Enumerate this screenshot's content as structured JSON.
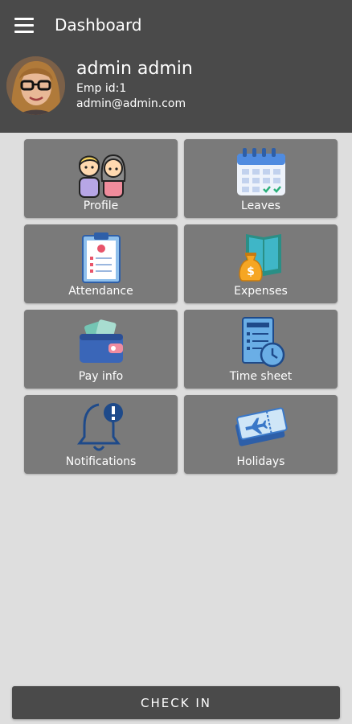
{
  "appbar": {
    "title": "Dashboard",
    "menu_icon": "hamburger-menu-icon"
  },
  "user": {
    "name": "admin admin",
    "emp_id": "Emp id:1",
    "email": "admin@admin.com"
  },
  "tiles": [
    {
      "label": "Profile",
      "icon": "users-icon"
    },
    {
      "label": "Leaves",
      "icon": "calendar-icon"
    },
    {
      "label": "Attendance",
      "icon": "clipboard-icon"
    },
    {
      "label": "Expenses",
      "icon": "money-bag-book-icon"
    },
    {
      "label": "Pay info",
      "icon": "wallet-icon"
    },
    {
      "label": "Time sheet",
      "icon": "timesheet-clock-icon"
    },
    {
      "label": "Notifications",
      "icon": "bell-alert-icon"
    },
    {
      "label": "Holidays",
      "icon": "plane-ticket-icon"
    }
  ],
  "footer": {
    "checkin_label": "CHECK IN"
  },
  "colors": {
    "bar": "#4a4a4a",
    "tile": "#7a7a7a",
    "background": "#dedede"
  }
}
